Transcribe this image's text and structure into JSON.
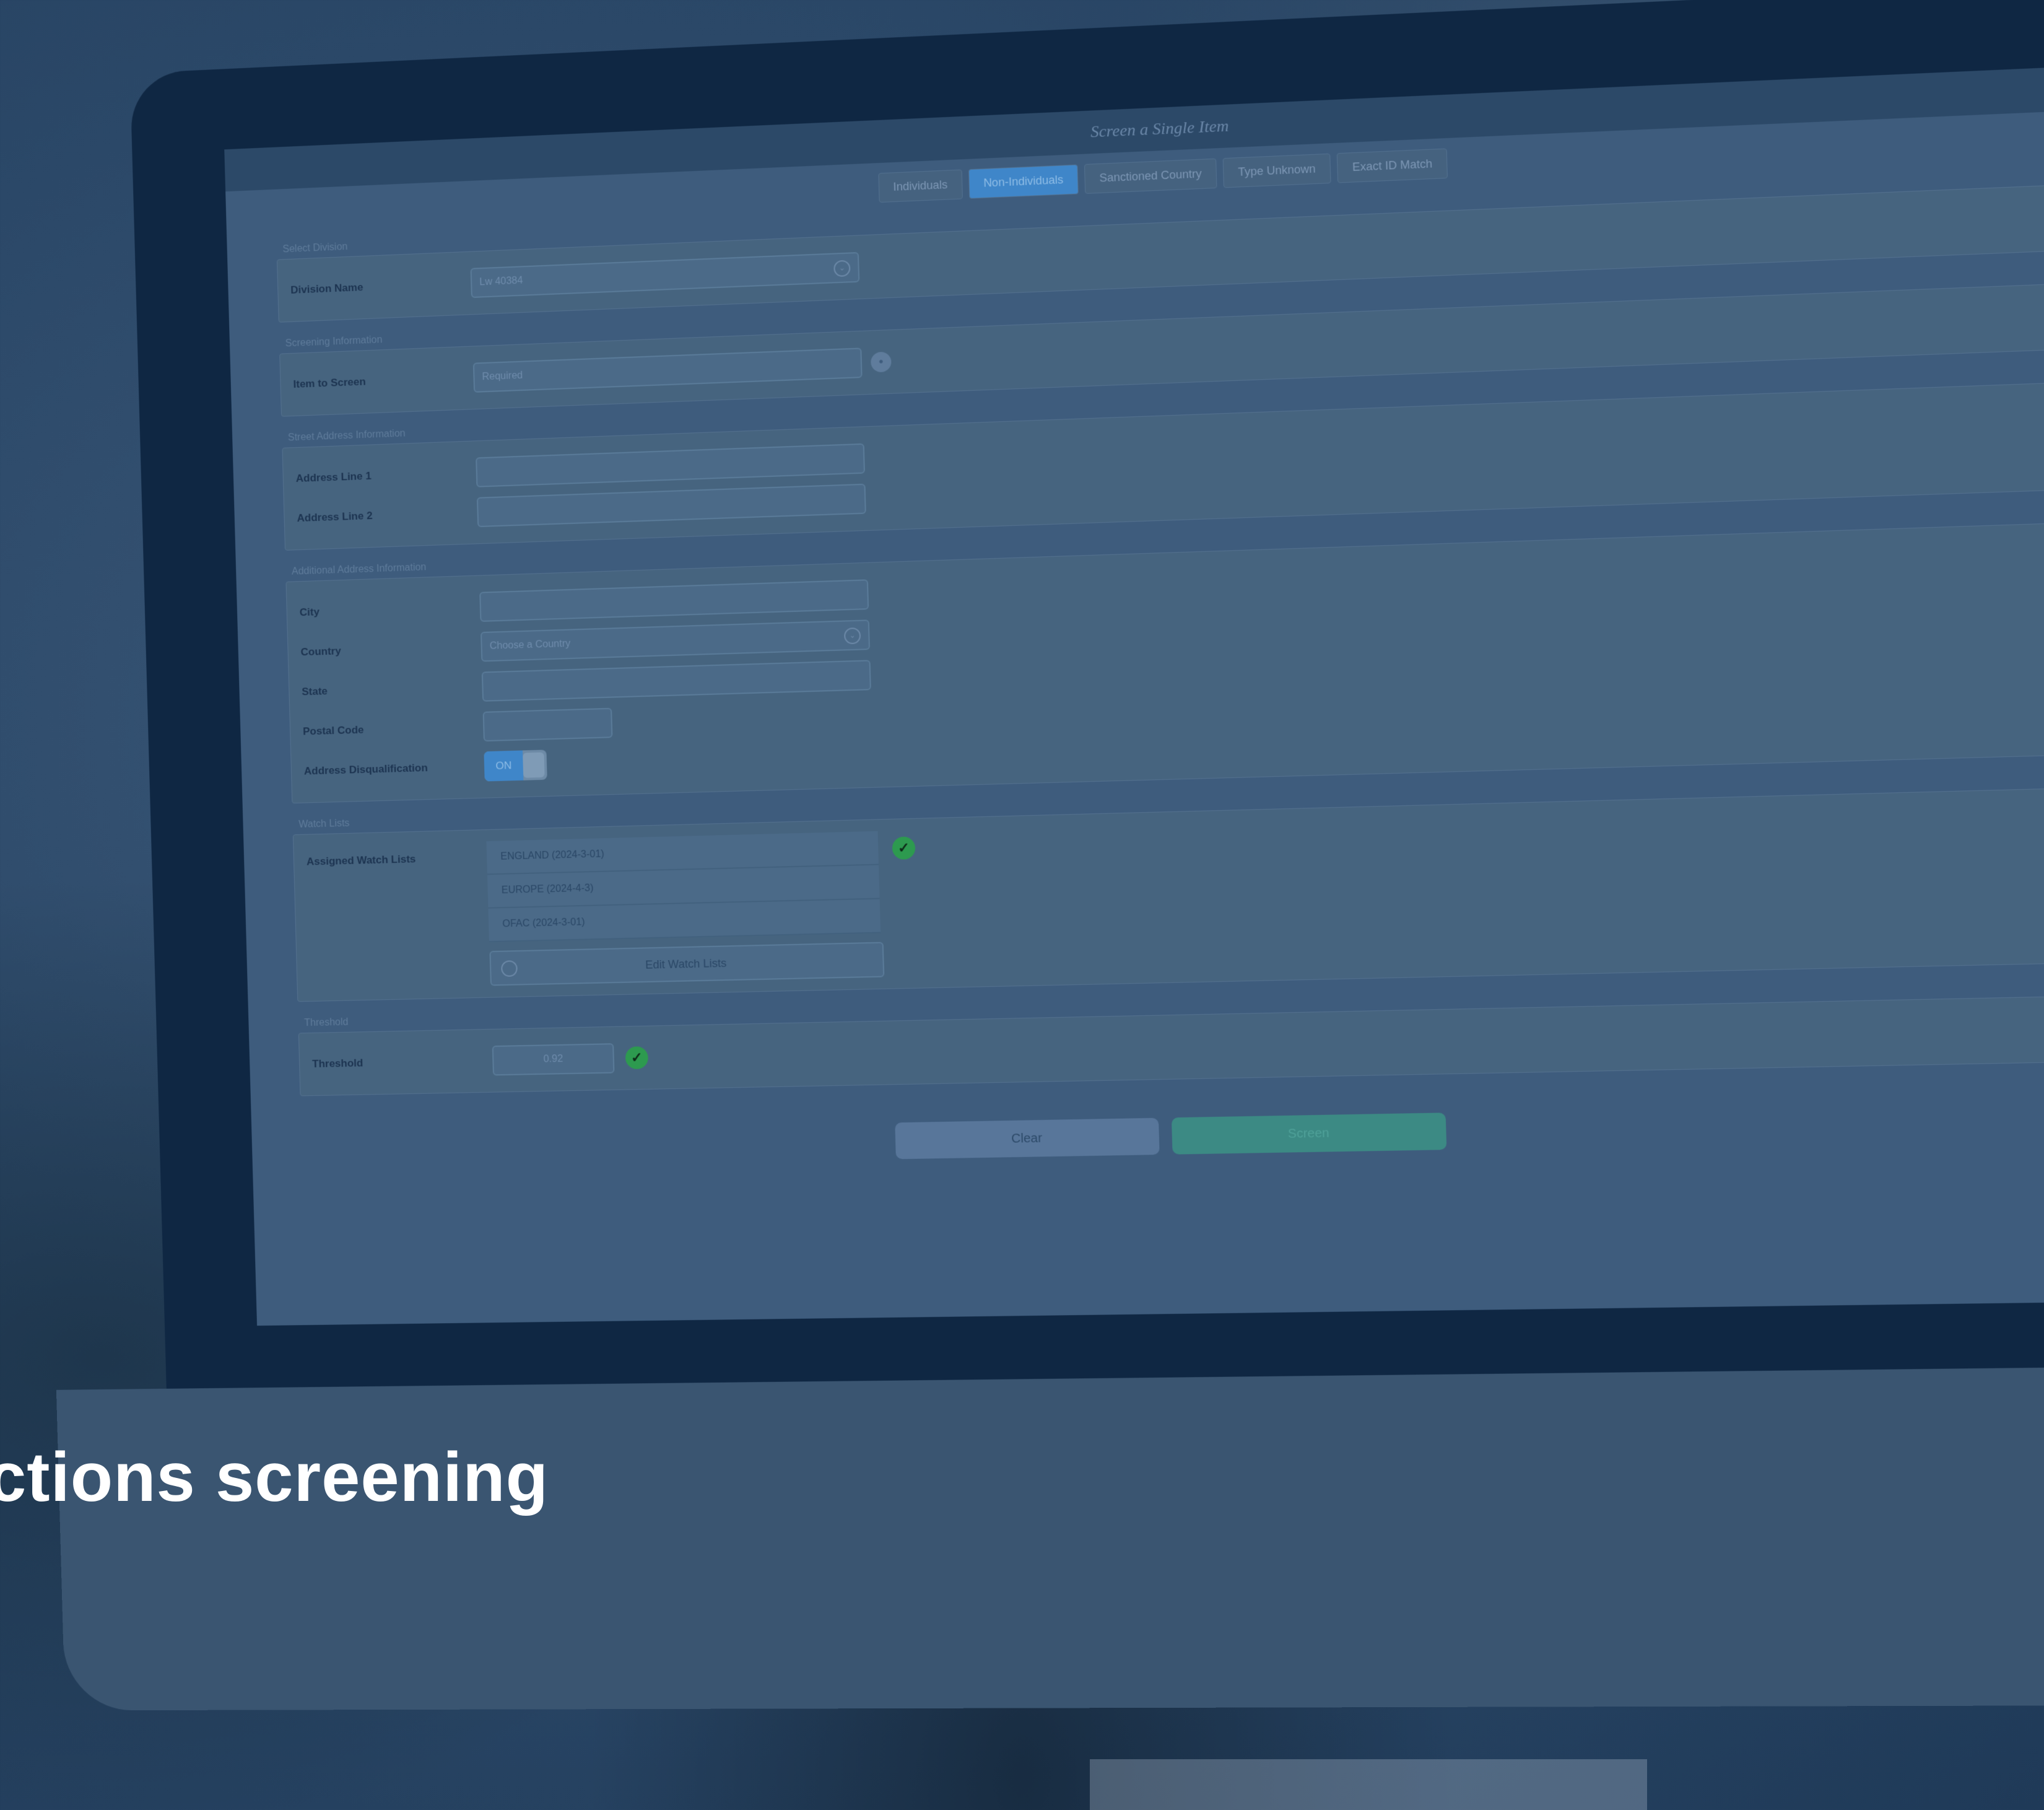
{
  "app": {
    "window_title": "Screen a Single Item"
  },
  "tabs": [
    {
      "label": "Individuals",
      "active": false
    },
    {
      "label": "Non-Individuals",
      "active": true
    },
    {
      "label": "Sanctioned Country",
      "active": false
    },
    {
      "label": "Type Unknown",
      "active": false
    },
    {
      "label": "Exact ID Match",
      "active": false
    }
  ],
  "sections": {
    "select_division": {
      "label": "Select Division",
      "field_label": "Division Name",
      "field_value": "Lw 40384"
    },
    "screening_information": {
      "label": "Screening Information",
      "field_label": "Item to Screen",
      "field_placeholder": "Required"
    },
    "street_address": {
      "label": "Street Address Information",
      "line1_label": "Address Line 1",
      "line1_value": "",
      "line2_label": "Address Line 2",
      "line2_value": ""
    },
    "additional_address": {
      "label": "Additional Address Information",
      "city_label": "City",
      "city_value": "",
      "country_label": "Country",
      "country_value": "Choose a Country",
      "state_label": "State",
      "state_value": "",
      "postal_label": "Postal Code",
      "postal_value": "",
      "dedup_label": "Address Disqualification",
      "dedup_toggle": "ON"
    },
    "watch_list": {
      "label": "Watch Lists",
      "field_label": "Assigned Watch Lists",
      "items": [
        "ENGLAND (2024-3-01)",
        "EUROPE (2024-4-3)",
        "OFAC (2024-3-01)"
      ],
      "edit_label": "Edit Watch Lists"
    },
    "threshold": {
      "label": "Threshold",
      "field_label": "Threshold",
      "field_value": "0.92"
    }
  },
  "actions": {
    "clear_label": "Clear",
    "screen_label": "Screen"
  },
  "caption": "ctions screening",
  "colors": {
    "overlay": "#2b4868",
    "active_tab": "#3f86c9",
    "check": "#2d9a4f",
    "screen_button": "#3c8a84"
  }
}
